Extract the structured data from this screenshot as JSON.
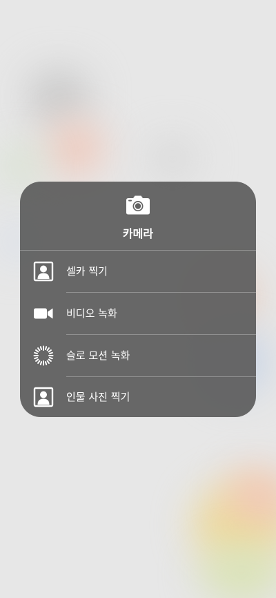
{
  "menu": {
    "title": "카메라",
    "header_icon": "camera-icon",
    "items": [
      {
        "label": "셀카 찍기",
        "icon": "portrait-frame-icon"
      },
      {
        "label": "비디오 녹화",
        "icon": "video-camera-icon"
      },
      {
        "label": "슬로 모션 녹화",
        "icon": "slow-motion-icon"
      },
      {
        "label": "인물 사진 찍기",
        "icon": "portrait-frame-icon"
      }
    ]
  },
  "colors": {
    "menu_background": "#626262",
    "text": "#ffffff",
    "page_background": "#e7e7e7"
  }
}
